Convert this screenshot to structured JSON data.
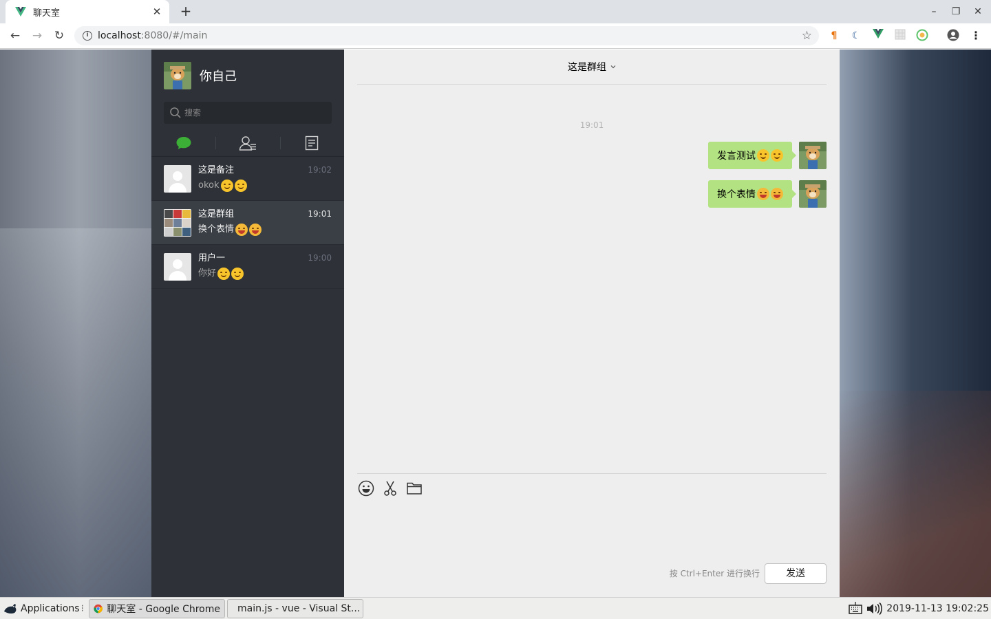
{
  "browser": {
    "tab_title": "聊天室",
    "url_host": "localhost",
    "url_rest": ":8080/#/main"
  },
  "user": {
    "name": "你自己"
  },
  "search": {
    "placeholder": "搜索"
  },
  "conversations": [
    {
      "name": "这是备注",
      "time": "19:02",
      "preview": "okok"
    },
    {
      "name": "这是群组",
      "time": "19:01",
      "preview": "换个表情"
    },
    {
      "name": "用户一",
      "time": "19:00",
      "preview": "你好"
    }
  ],
  "chat": {
    "title": "这是群组",
    "timestamp": "19:01",
    "messages": [
      {
        "text": "发言测试"
      },
      {
        "text": "换个表情"
      }
    ],
    "hint": "按 Ctrl+Enter 进行换行",
    "send_label": "发送"
  },
  "taskbar": {
    "applications": "Applications",
    "items": [
      {
        "label": "聊天室 - Google Chrome"
      },
      {
        "label": "main.js - vue - Visual St..."
      }
    ],
    "clock": "2019-11-13 19:02:25"
  },
  "colors": {
    "sidebar": "#2e3238",
    "bubble": "#b2e281",
    "chat_bg": "#eeeeee",
    "accent_green": "#3caf36"
  }
}
